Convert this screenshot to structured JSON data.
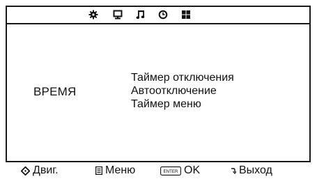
{
  "tabs": [
    {
      "icon": "gear-icon"
    },
    {
      "icon": "monitor-icon"
    },
    {
      "icon": "music-note-icon"
    },
    {
      "icon": "clock-icon"
    },
    {
      "icon": "grid-icon"
    }
  ],
  "section": {
    "title": "ВРЕМЯ"
  },
  "menu": {
    "items": [
      {
        "label": "Таймер отключения"
      },
      {
        "label": "Автоотключение"
      },
      {
        "label": "Таймер меню"
      }
    ]
  },
  "hints": {
    "move": {
      "icon": "dpad-icon",
      "label": "Двиг."
    },
    "menu": {
      "icon": "menu-icon",
      "label": "Меню"
    },
    "ok": {
      "icon": "enter-key-icon",
      "key": "ENTER",
      "label": "OK"
    },
    "exit": {
      "icon": "back-icon",
      "label": "Выход"
    }
  }
}
